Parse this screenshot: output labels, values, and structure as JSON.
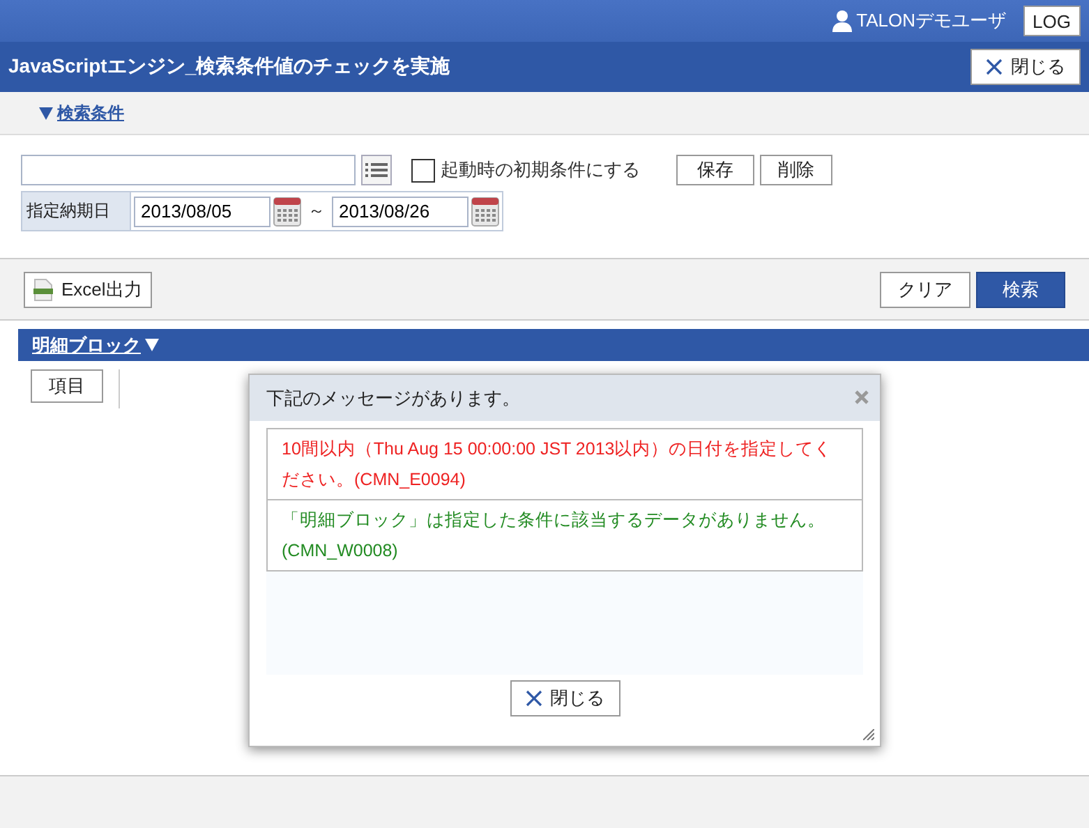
{
  "header": {
    "user": "TALONデモユーザ",
    "logout": "LOG",
    "title": "JavaScriptエンジン_検索条件値のチェックを実施",
    "close": "閉じる"
  },
  "conditions": {
    "toggle": "検索条件",
    "expanded": true,
    "preset_checkbox": {
      "label": "起動時の初期条件にする",
      "checked": false
    },
    "save": "保存",
    "delete": "削除",
    "date_label": "指定納期日",
    "date_from": "2013/08/05",
    "separator": "～",
    "date_to": "2013/08/26"
  },
  "toolbar": {
    "excel": "Excel出力",
    "clear": "クリア",
    "search": "検索"
  },
  "detail": {
    "title": "明細ブロック",
    "expanded": true,
    "item_button": "項目"
  },
  "dialog": {
    "title": "下記のメッセージがあります。",
    "messages": [
      {
        "kind": "error",
        "text": "10間以内（Thu Aug 15 00:00:00 JST 2013以内）の日付を指定してください。(CMN_E0094)"
      },
      {
        "kind": "warning",
        "text": "「明細ブロック」は指定した条件に該当するデータがありません。(CMN_W0008)"
      }
    ],
    "close": "閉じる"
  }
}
